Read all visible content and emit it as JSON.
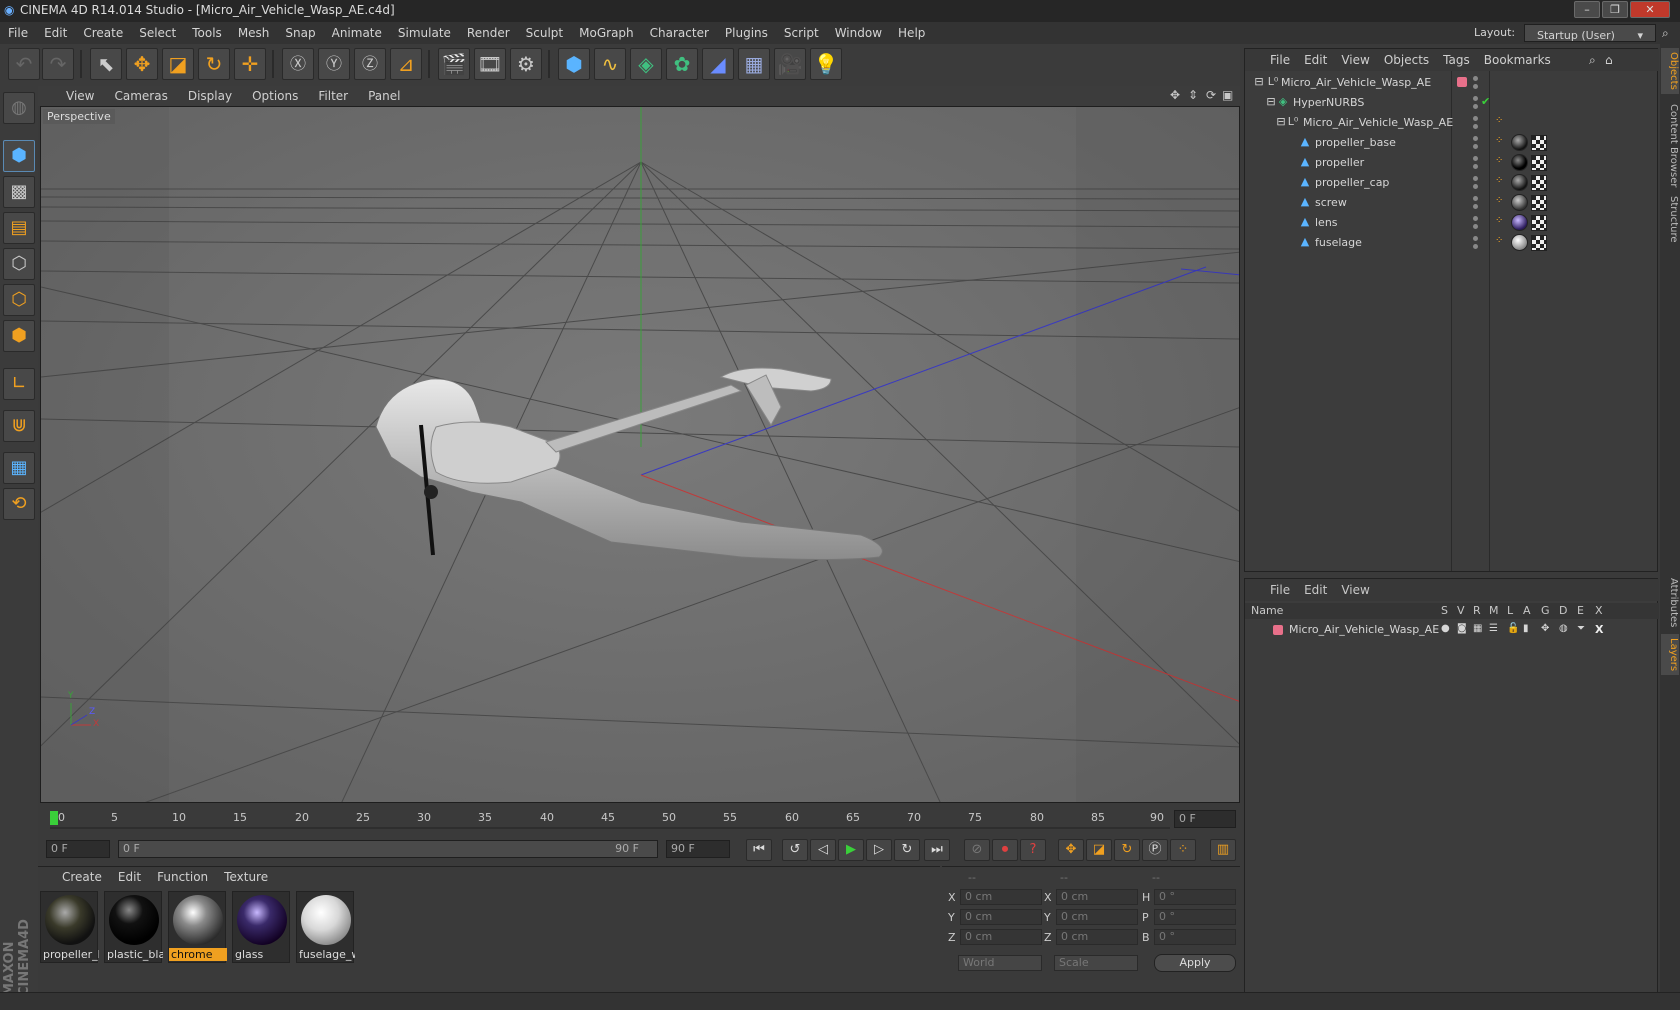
{
  "window": {
    "title": "CINEMA 4D R14.014 Studio - [Micro_Air_Vehicle_Wasp_AE.c4d]"
  },
  "menubar": [
    "File",
    "Edit",
    "Create",
    "Select",
    "Tools",
    "Mesh",
    "Snap",
    "Animate",
    "Simulate",
    "Render",
    "Sculpt",
    "MoGraph",
    "Character",
    "Plugins",
    "Script",
    "Window",
    "Help"
  ],
  "layout": {
    "label": "Layout:",
    "value": "Startup (User)"
  },
  "viewport": {
    "menu": [
      "View",
      "Cameras",
      "Display",
      "Options",
      "Filter",
      "Panel"
    ],
    "label": "Perspective",
    "axis": {
      "x": "X",
      "y": "Y",
      "z": "Z"
    }
  },
  "timeline": {
    "ticks": [
      "0",
      "5",
      "10",
      "15",
      "20",
      "25",
      "30",
      "35",
      "40",
      "45",
      "50",
      "55",
      "60",
      "65",
      "70",
      "75",
      "80",
      "85",
      "90"
    ],
    "current_frame": "0 F",
    "start": "0 F",
    "range_start": "0 F",
    "range_end": "90 F",
    "end": "90 F"
  },
  "materials": {
    "menu": [
      "Create",
      "Edit",
      "Function",
      "Texture"
    ],
    "items": [
      {
        "label": "propeller_b",
        "color": "#2a2a2a"
      },
      {
        "label": "plastic_bla",
        "color": "#0a0a0a"
      },
      {
        "label": "chrome",
        "color": "#8a8a8a"
      },
      {
        "label": "glass",
        "color": "#3a2a6a"
      },
      {
        "label": "fuselage_w",
        "color": "#d8d8d8"
      }
    ],
    "selected_index": 2,
    "brand": "MAXON CINEMA4D"
  },
  "coords": {
    "headers": [
      "--",
      "--",
      "--"
    ],
    "rows": [
      {
        "a": "X",
        "av": "0 cm",
        "b": "X",
        "bv": "0 cm",
        "c": "H",
        "cv": "0 °"
      },
      {
        "a": "Y",
        "av": "0 cm",
        "b": "Y",
        "bv": "0 cm",
        "c": "P",
        "cv": "0 °"
      },
      {
        "a": "Z",
        "av": "0 cm",
        "b": "Z",
        "bv": "0 cm",
        "c": "B",
        "cv": "0 °"
      }
    ],
    "space": "World",
    "mode": "Scale",
    "apply": "Apply"
  },
  "objects": {
    "menu": [
      "File",
      "Edit",
      "View",
      "Objects",
      "Tags",
      "Bookmarks"
    ],
    "items": [
      {
        "name": "Micro_Air_Vehicle_Wasp_AE",
        "icon": "null-icon"
      },
      {
        "name": "HyperNURBS",
        "icon": "hypernurbs-icon"
      },
      {
        "name": "Micro_Air_Vehicle_Wasp_AE",
        "icon": "null-icon"
      },
      {
        "name": "propeller_base",
        "icon": "polygon-icon"
      },
      {
        "name": "propeller",
        "icon": "polygon-icon"
      },
      {
        "name": "propeller_cap",
        "icon": "polygon-icon"
      },
      {
        "name": "screw",
        "icon": "polygon-icon"
      },
      {
        "name": "lens",
        "icon": "polygon-icon"
      },
      {
        "name": "fuselage",
        "icon": "polygon-icon"
      }
    ]
  },
  "layers": {
    "menu": [
      "File",
      "Edit",
      "View"
    ],
    "columns": [
      "Name",
      "S",
      "V",
      "R",
      "M",
      "L",
      "A",
      "G",
      "D",
      "E",
      "X"
    ],
    "items": [
      {
        "name": "Micro_Air_Vehicle_Wasp_AE",
        "color": "#e8708a"
      }
    ]
  },
  "side_tabs": [
    "Objects",
    "Content Browser",
    "Structure",
    "Attributes",
    "Layers"
  ]
}
